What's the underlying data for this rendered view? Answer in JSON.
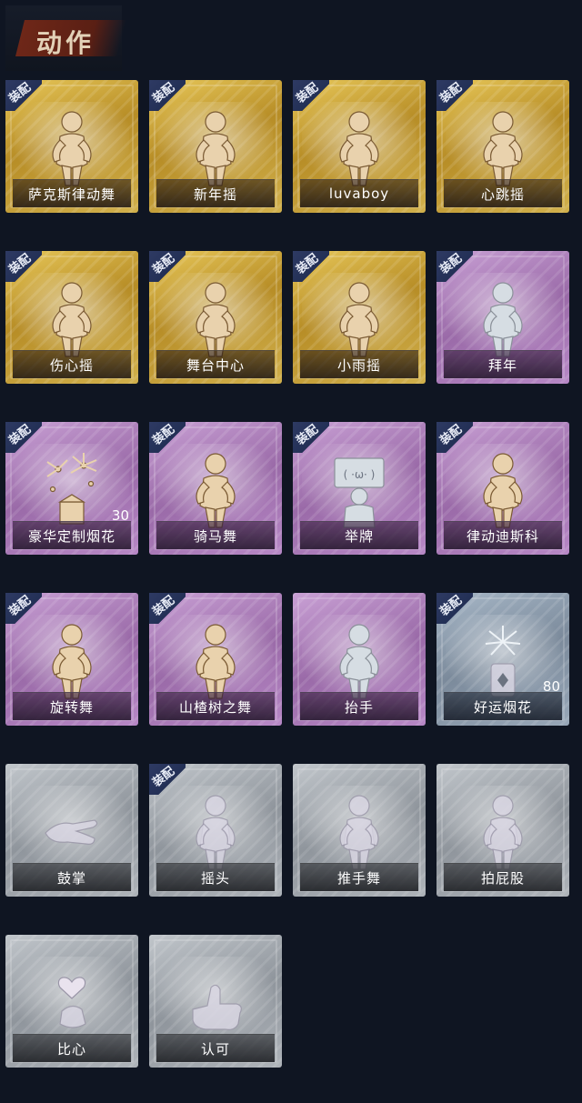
{
  "header": {
    "title": "动作"
  },
  "equip_label": "装配",
  "cards": [
    {
      "name": "萨克斯律动舞",
      "rarity": "gold",
      "equipped": true,
      "icon": "saxophone-dancer-icon"
    },
    {
      "name": "新年摇",
      "rarity": "gold",
      "equipped": true,
      "icon": "clapping-figure-icon"
    },
    {
      "name": "luvaboy",
      "rarity": "gold",
      "equipped": true,
      "icon": "arm-wave-figure-icon"
    },
    {
      "name": "心跳摇",
      "rarity": "gold",
      "equipped": true,
      "icon": "heartbeat-figure-icon"
    },
    {
      "name": "伤心摇",
      "rarity": "gold",
      "equipped": true,
      "icon": "heart-hands-figure-icon"
    },
    {
      "name": "舞台中心",
      "rarity": "gold",
      "equipped": true,
      "icon": "stage-pose-figure-icon"
    },
    {
      "name": "小雨摇",
      "rarity": "gold",
      "equipped": true,
      "icon": "rain-dance-figure-icon"
    },
    {
      "name": "拜年",
      "rarity": "purple",
      "equipped": true,
      "icon": "bow-greeting-figure-icon"
    },
    {
      "name": "豪华定制烟花",
      "rarity": "purple",
      "equipped": true,
      "icon": "fireworks-box-icon",
      "count": "30"
    },
    {
      "name": "骑马舞",
      "rarity": "purple",
      "equipped": true,
      "icon": "horse-dance-figure-icon"
    },
    {
      "name": "举牌",
      "rarity": "purple",
      "equipped": true,
      "icon": "hold-sign-figure-icon"
    },
    {
      "name": "律动迪斯科",
      "rarity": "purple",
      "equipped": true,
      "icon": "disco-pose-figure-icon"
    },
    {
      "name": "旋转舞",
      "rarity": "purple",
      "equipped": true,
      "icon": "spin-dance-figure-icon"
    },
    {
      "name": "山楂树之舞",
      "rarity": "purple",
      "equipped": true,
      "icon": "hawthorn-dance-figure-icon"
    },
    {
      "name": "抬手",
      "rarity": "purple",
      "equipped": false,
      "icon": "raise-hand-figure-icon"
    },
    {
      "name": "好运烟花",
      "rarity": "blue",
      "equipped": true,
      "icon": "lucky-firework-icon",
      "count": "80"
    },
    {
      "name": "鼓掌",
      "rarity": "gray",
      "equipped": false,
      "icon": "clap-hands-icon"
    },
    {
      "name": "摇头",
      "rarity": "gray",
      "equipped": true,
      "icon": "head-shake-figure-icon"
    },
    {
      "name": "推手舞",
      "rarity": "gray",
      "equipped": false,
      "icon": "push-hands-figure-icon"
    },
    {
      "name": "拍屁股",
      "rarity": "gray",
      "equipped": false,
      "icon": "pat-figure-icon"
    },
    {
      "name": "比心",
      "rarity": "gray",
      "equipped": false,
      "icon": "finger-heart-icon"
    },
    {
      "name": "认可",
      "rarity": "gray",
      "equipped": false,
      "icon": "thumbs-up-icon"
    }
  ]
}
